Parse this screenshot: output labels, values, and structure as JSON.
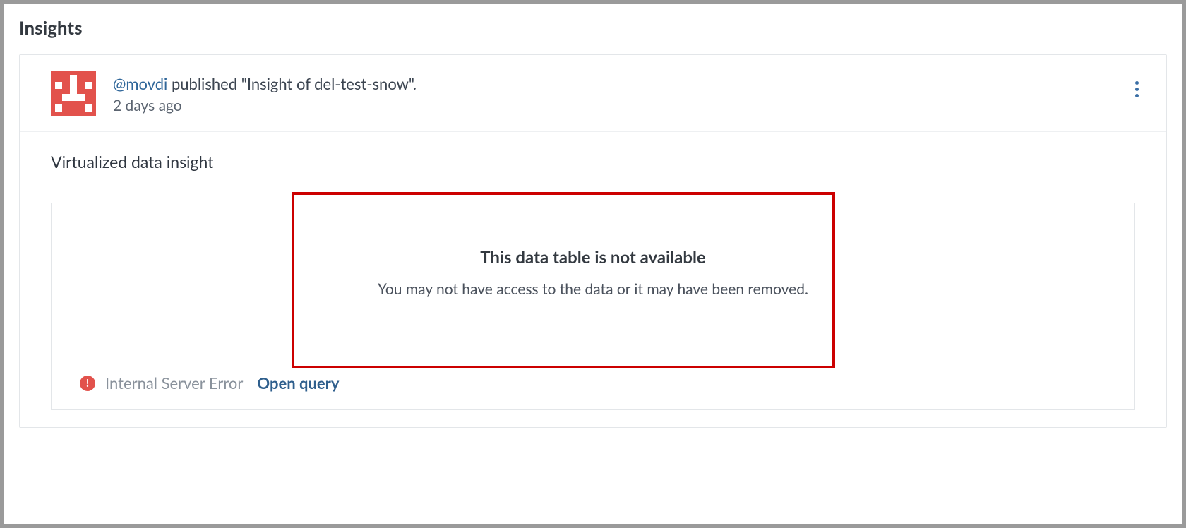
{
  "page": {
    "title": "Insights"
  },
  "insight": {
    "user_handle": "@movdi",
    "publish_suffix": " published \"Insight of del-test-snow\".",
    "time_ago": "2 days ago",
    "title": "Virtualized data insight"
  },
  "empty_state": {
    "heading": "This data table is not available",
    "subtext": "You may not have access to the data or it may have been removed."
  },
  "error": {
    "message": "Internal Server Error",
    "action_label": "Open query"
  }
}
